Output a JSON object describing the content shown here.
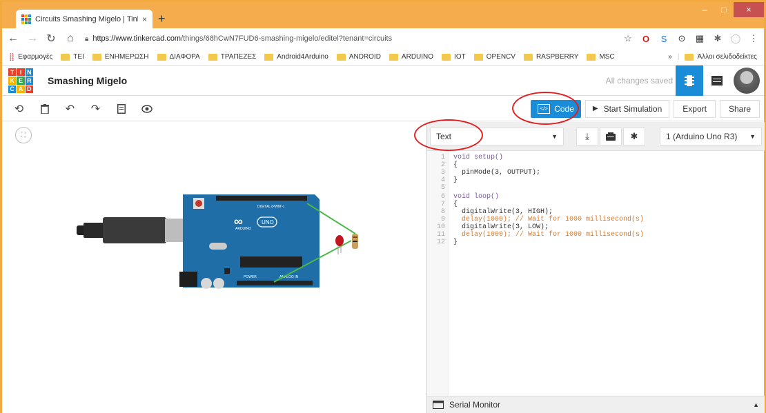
{
  "browser": {
    "tab_title": "Circuits Smashing Migelo | Tinke",
    "tab_close": "×",
    "new_tab": "+",
    "url_host": "https://www.tinkercad.com",
    "url_path": "/things/68hCwN7FUD6-smashing-migelo/editel?tenant=circuits",
    "window_controls": {
      "minimize": "–",
      "maximize": "□",
      "close": "×"
    }
  },
  "bookmarks": {
    "apps": "Εφαρμογές",
    "items": [
      "TEI",
      "ΕΝΗΜΕΡΩΣΗ",
      "ΔΙΑΦΟΡΑ",
      "ΤΡΑΠΕΖΕΣ",
      "Android4Arduino",
      "ANDROID",
      "ARDUINO",
      "IOT",
      "OPENCV",
      "RASPBERRY",
      "MSC"
    ],
    "more": "»",
    "other": "Άλλοι σελιδοδείκτες"
  },
  "app": {
    "logo_letters": [
      "T",
      "I",
      "N",
      "K",
      "E",
      "R",
      "C",
      "A",
      "D"
    ],
    "project_title": "Smashing Migelo",
    "saved_status": "All changes saved"
  },
  "toolbar": {
    "code_label": "Code",
    "code_icon": "</>",
    "start_sim_label": "Start Simulation",
    "export_label": "Export",
    "share_label": "Share"
  },
  "code_panel": {
    "mode": "Text",
    "board": "1 (Arduino Uno R3)",
    "serial_monitor": "Serial Monitor",
    "line_numbers": [
      "1",
      "2",
      "3",
      "4",
      "5",
      "6",
      "7",
      "8",
      "9",
      "10",
      "11",
      "12"
    ],
    "lines": [
      "void setup()",
      "{",
      "  pinMode(3, OUTPUT);",
      "}",
      "",
      "void loop()",
      "{",
      "  digitalWrite(3, HIGH);",
      "  delay(1000); // Wait for 1000 millisecond(s)",
      "  digitalWrite(3, LOW);",
      "  delay(1000); // Wait for 1000 millisecond(s)",
      "}"
    ]
  },
  "board": {
    "brand": "ARDUINO",
    "model": "UNO",
    "digital_label": "DIGITAL (PWM~)",
    "analog_label": "ANALOG IN",
    "power_label": "POWER"
  },
  "colors": {
    "accent": "#1a8cd8",
    "board": "#1f6ea8",
    "annotation": "#e02020"
  }
}
